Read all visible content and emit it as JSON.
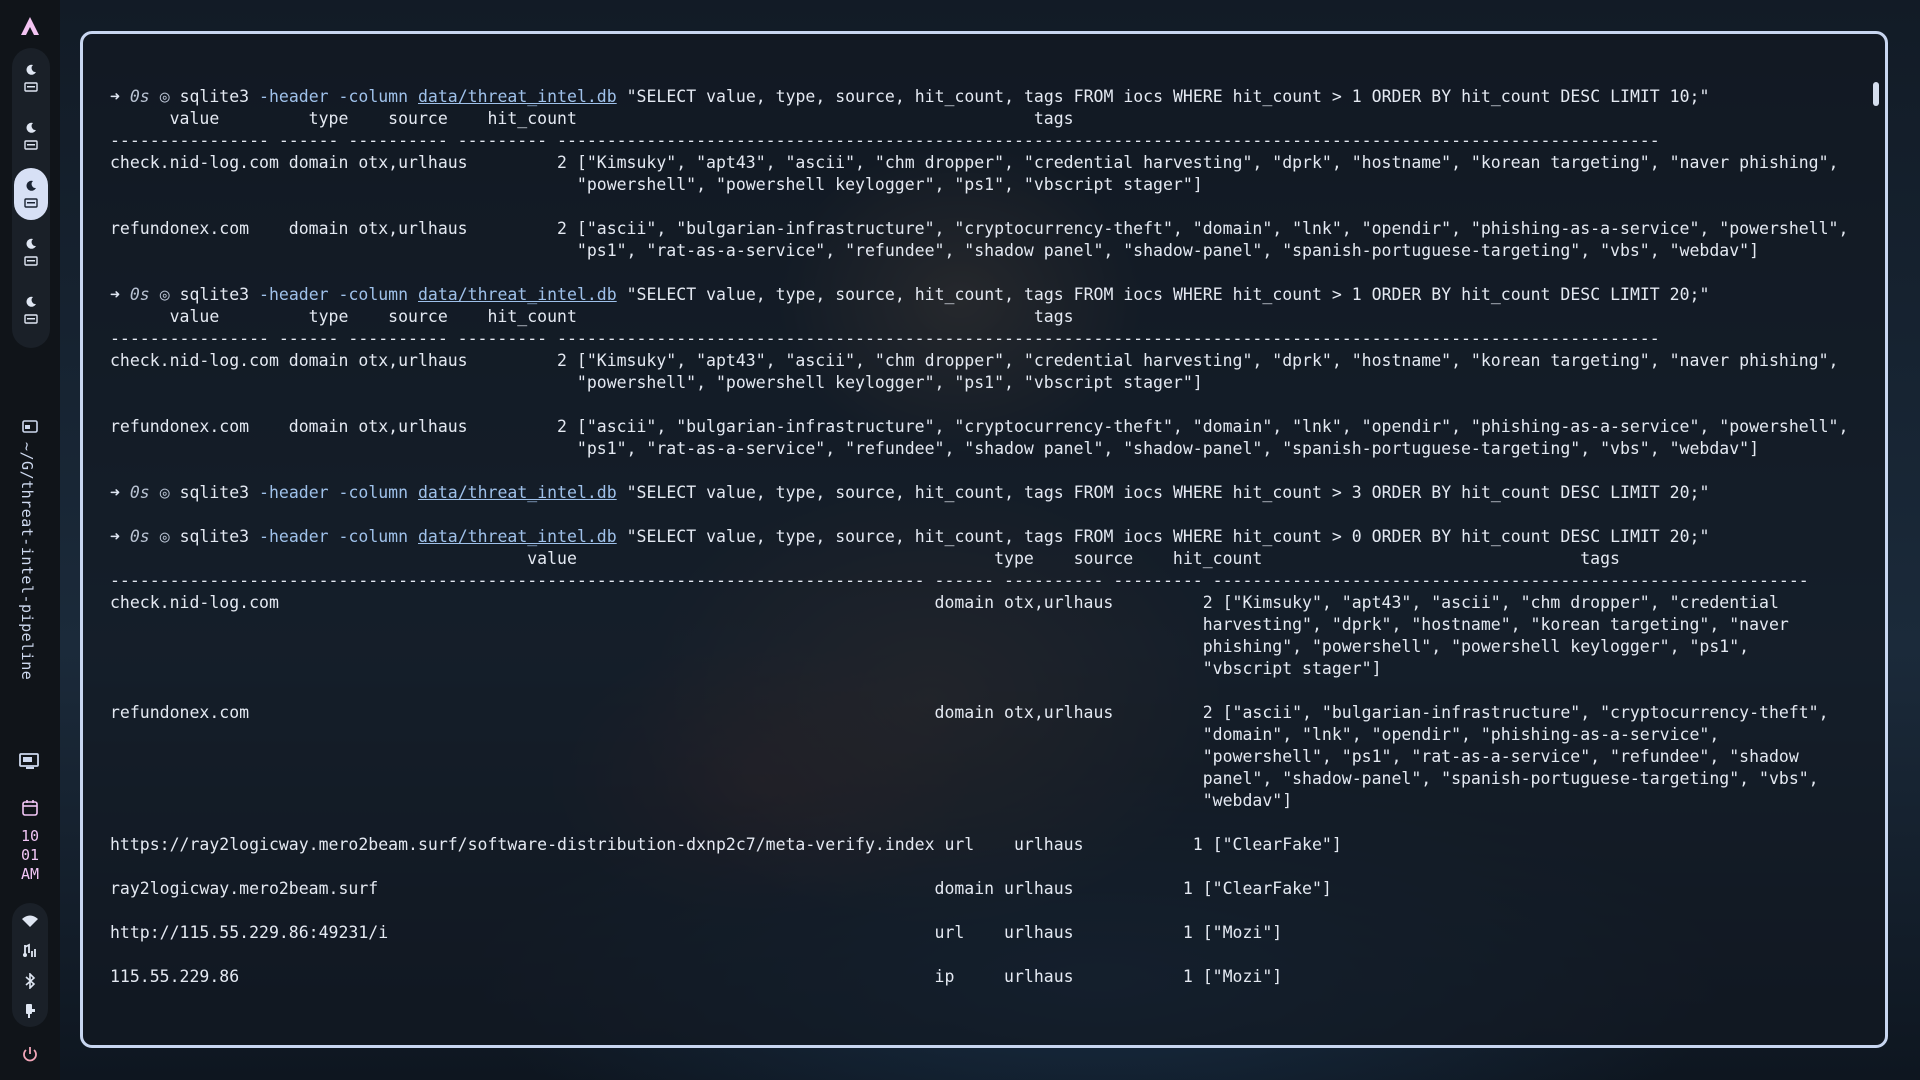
{
  "sidebar": {
    "workspaces": [
      {
        "icon": "moon-icon",
        "active": false
      },
      {
        "icon": "moon-icon",
        "active": false
      },
      {
        "icon": "moon-icon",
        "active": true
      },
      {
        "icon": "moon-icon",
        "active": false
      },
      {
        "icon": "moon-icon",
        "active": false
      }
    ],
    "active_window_title": "~/G/threat-intel-pipeline",
    "clock": {
      "hour": "10",
      "minute": "01",
      "ampm": "AM"
    },
    "status_icons": [
      "wifi-icon",
      "audio-icon",
      "bluetooth-icon",
      "battery-icon"
    ],
    "power_icon": "power-icon"
  },
  "terminal": {
    "lines": [
      {
        "kind": "prompt",
        "arrow": "➜",
        "time": "0s",
        "sep": "◎",
        "prog": "sqlite3",
        "flags": "-header -column",
        "db": "data/threat_intel.db",
        "query": "\"SELECT value, type, source, hit_count, tags FROM iocs WHERE hit_count > 1 ORDER BY hit_count DESC LIMIT 10;\""
      },
      {
        "kind": "text",
        "text": "      value         type    source    hit_count                                              tags"
      },
      {
        "kind": "text",
        "text": "---------------- ------ ---------- --------- ---------------------------------------------------------------------------------------------------------------"
      },
      {
        "kind": "text",
        "text": "check.nid-log.com domain otx,urlhaus         2 [\"Kimsuky\", \"apt43\", \"ascii\", \"chm dropper\", \"credential harvesting\", \"dprk\", \"hostname\", \"korean targeting\", \"naver phishing\","
      },
      {
        "kind": "text",
        "text": "                                               \"powershell\", \"powershell keylogger\", \"ps1\", \"vbscript stager\"]"
      },
      {
        "kind": "text",
        "text": ""
      },
      {
        "kind": "text",
        "text": "refundonex.com    domain otx,urlhaus         2 [\"ascii\", \"bulgarian-infrastructure\", \"cryptocurrency-theft\", \"domain\", \"lnk\", \"opendir\", \"phishing-as-a-service\", \"powershell\","
      },
      {
        "kind": "text",
        "text": "                                               \"ps1\", \"rat-as-a-service\", \"refundee\", \"shadow panel\", \"shadow-panel\", \"spanish-portuguese-targeting\", \"vbs\", \"webdav\"]"
      },
      {
        "kind": "text",
        "text": ""
      },
      {
        "kind": "prompt",
        "arrow": "➜",
        "time": "0s",
        "sep": "◎",
        "prog": "sqlite3",
        "flags": "-header -column",
        "db": "data/threat_intel.db",
        "query": "\"SELECT value, type, source, hit_count, tags FROM iocs WHERE hit_count > 1 ORDER BY hit_count DESC LIMIT 20;\""
      },
      {
        "kind": "text",
        "text": "      value         type    source    hit_count                                              tags"
      },
      {
        "kind": "text",
        "text": "---------------- ------ ---------- --------- ---------------------------------------------------------------------------------------------------------------"
      },
      {
        "kind": "text",
        "text": "check.nid-log.com domain otx,urlhaus         2 [\"Kimsuky\", \"apt43\", \"ascii\", \"chm dropper\", \"credential harvesting\", \"dprk\", \"hostname\", \"korean targeting\", \"naver phishing\","
      },
      {
        "kind": "text",
        "text": "                                               \"powershell\", \"powershell keylogger\", \"ps1\", \"vbscript stager\"]"
      },
      {
        "kind": "text",
        "text": ""
      },
      {
        "kind": "text",
        "text": "refundonex.com    domain otx,urlhaus         2 [\"ascii\", \"bulgarian-infrastructure\", \"cryptocurrency-theft\", \"domain\", \"lnk\", \"opendir\", \"phishing-as-a-service\", \"powershell\","
      },
      {
        "kind": "text",
        "text": "                                               \"ps1\", \"rat-as-a-service\", \"refundee\", \"shadow panel\", \"shadow-panel\", \"spanish-portuguese-targeting\", \"vbs\", \"webdav\"]"
      },
      {
        "kind": "text",
        "text": ""
      },
      {
        "kind": "prompt",
        "arrow": "➜",
        "time": "0s",
        "sep": "◎",
        "prog": "sqlite3",
        "flags": "-header -column",
        "db": "data/threat_intel.db",
        "query": "\"SELECT value, type, source, hit_count, tags FROM iocs WHERE hit_count > 3 ORDER BY hit_count DESC LIMIT 20;\""
      },
      {
        "kind": "text",
        "text": ""
      },
      {
        "kind": "prompt",
        "arrow": "➜",
        "time": "0s",
        "sep": "◎",
        "prog": "sqlite3",
        "flags": "-header -column",
        "db": "data/threat_intel.db",
        "query": "\"SELECT value, type, source, hit_count, tags FROM iocs WHERE hit_count > 0 ORDER BY hit_count DESC LIMIT 20;\""
      },
      {
        "kind": "text",
        "text": "                                          value                                          type    source    hit_count                                tags"
      },
      {
        "kind": "text",
        "text": "---------------------------------------------------------------------------------- ------ ---------- --------- ------------------------------------------------------------"
      },
      {
        "kind": "text",
        "text": "check.nid-log.com                                                                  domain otx,urlhaus         2 [\"Kimsuky\", \"apt43\", \"ascii\", \"chm dropper\", \"credential"
      },
      {
        "kind": "text",
        "text": "                                                                                                              harvesting\", \"dprk\", \"hostname\", \"korean targeting\", \"naver"
      },
      {
        "kind": "text",
        "text": "                                                                                                              phishing\", \"powershell\", \"powershell keylogger\", \"ps1\","
      },
      {
        "kind": "text",
        "text": "                                                                                                              \"vbscript stager\"]"
      },
      {
        "kind": "text",
        "text": ""
      },
      {
        "kind": "text",
        "text": "refundonex.com                                                                     domain otx,urlhaus         2 [\"ascii\", \"bulgarian-infrastructure\", \"cryptocurrency-theft\","
      },
      {
        "kind": "text",
        "text": "                                                                                                              \"domain\", \"lnk\", \"opendir\", \"phishing-as-a-service\","
      },
      {
        "kind": "text",
        "text": "                                                                                                              \"powershell\", \"ps1\", \"rat-as-a-service\", \"refundee\", \"shadow"
      },
      {
        "kind": "text",
        "text": "                                                                                                              panel\", \"shadow-panel\", \"spanish-portuguese-targeting\", \"vbs\","
      },
      {
        "kind": "text",
        "text": "                                                                                                              \"webdav\"]"
      },
      {
        "kind": "text",
        "text": ""
      },
      {
        "kind": "text",
        "text": "https://ray2logicway.mero2beam.surf/software-distribution-dxnp2c7/meta-verify.index url    urlhaus           1 [\"ClearFake\"]"
      },
      {
        "kind": "text",
        "text": ""
      },
      {
        "kind": "text",
        "text": "ray2logicway.mero2beam.surf                                                        domain urlhaus           1 [\"ClearFake\"]"
      },
      {
        "kind": "text",
        "text": ""
      },
      {
        "kind": "text",
        "text": "http://115.55.229.86:49231/i                                                       url    urlhaus           1 [\"Mozi\"]"
      },
      {
        "kind": "text",
        "text": ""
      },
      {
        "kind": "text",
        "text": "115.55.229.86                                                                      ip     urlhaus           1 [\"Mozi\"]"
      }
    ]
  }
}
